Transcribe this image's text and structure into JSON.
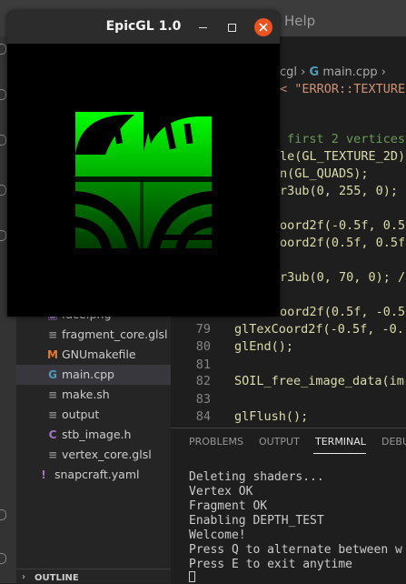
{
  "menubar": {
    "help_label": "Help"
  },
  "breadcrumb": {
    "folder": "cgl",
    "sep1": "›",
    "file": "main.cpp",
    "sep2": "›"
  },
  "explorer": {
    "files": [
      {
        "name": "face.png",
        "icon": "image-icon"
      },
      {
        "name": "fragment_core.glsl",
        "icon": "list-icon"
      },
      {
        "name": "GNUmakefile",
        "icon": "makefile-icon"
      },
      {
        "name": "main.cpp",
        "icon": "cpp-icon",
        "active": true
      },
      {
        "name": "make.sh",
        "icon": "list-icon"
      },
      {
        "name": "output",
        "icon": "list-icon"
      },
      {
        "name": "stb_image.h",
        "icon": "c-header-icon"
      },
      {
        "name": "vertex_core.glsl",
        "icon": "list-icon"
      },
      {
        "name": "snapcraft.yaml",
        "icon": "yaml-icon"
      }
    ],
    "outline_label": "OUTLINE"
  },
  "editor": {
    "upper_lines": [
      "< \"ERROR::TEXTURE",
      "first 2 vertices",
      "le(GL_TEXTURE_2D)",
      "n(GL_QUADS);",
      "r3ub(0, 255, 0);",
      "",
      "oord2f(-0.5f, 0.5",
      "oord2f(0.5f, 0.5f",
      "",
      "r3ub(0, 70, 0); /",
      "",
      "oord2f(0.5f, -0.5"
    ],
    "numbered_lines": [
      {
        "num": "79",
        "code": "glTexCoord2f(-0.5f, -0."
      },
      {
        "num": "80",
        "code": "glEnd();"
      },
      {
        "num": "81",
        "code": ""
      },
      {
        "num": "82",
        "code": "SOIL_free_image_data(im"
      },
      {
        "num": "83",
        "code": ""
      },
      {
        "num": "84",
        "code": "glFlush();"
      }
    ]
  },
  "panel": {
    "tabs": [
      "PROBLEMS",
      "OUTPUT",
      "TERMINAL",
      "DEBU"
    ],
    "active_tab": "TERMINAL",
    "terminal_lines": [
      "Deleting shaders...",
      "Vertex OK",
      "Fragment OK",
      "Enabling DEPTH_TEST",
      "Welcome!",
      "Press Q to alternate between w",
      "Press E to exit anytime"
    ]
  },
  "glwindow": {
    "title": "EpicGL 1.0",
    "colors": {
      "bright_green": "#00ff00",
      "dark_green": "#004600",
      "close": "#e95420"
    }
  }
}
